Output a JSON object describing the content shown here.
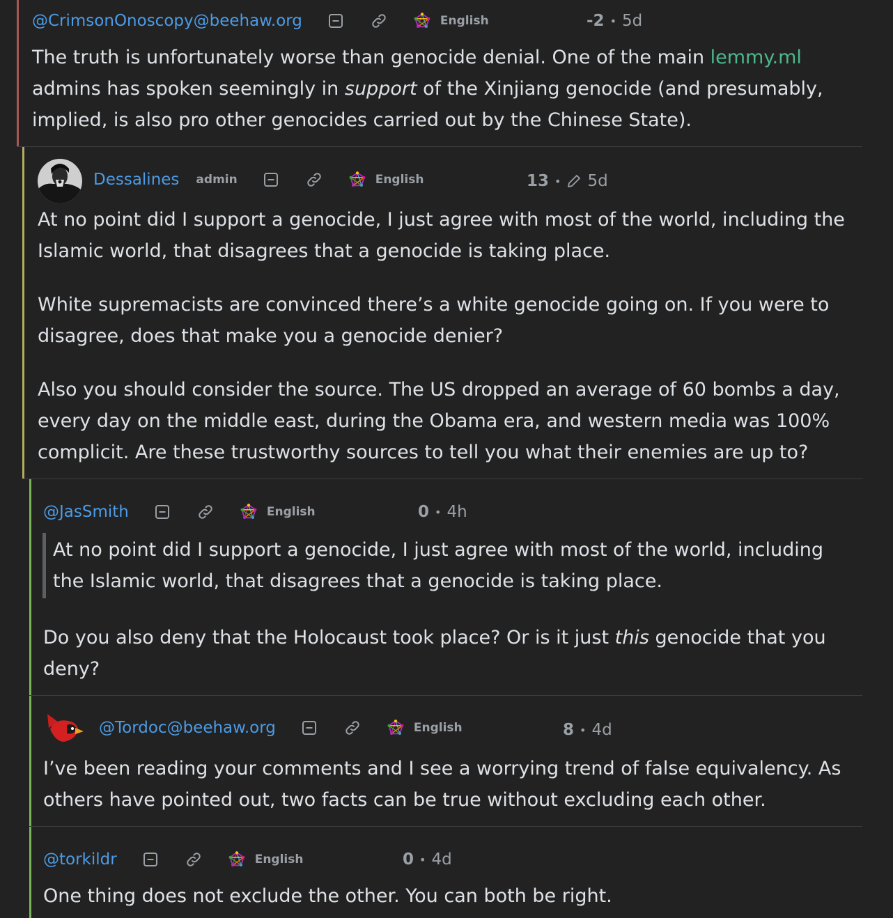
{
  "comments": [
    {
      "username": "@CrimsonOnoscopy@beehaw.org",
      "language": "English",
      "score": "-2",
      "time": "5d",
      "body": {
        "part1": "The truth is unfortunately worse than genocide denial. One of the main ",
        "link": "lemmy.ml",
        "part2": "admins has spoken seemingly in ",
        "emph": "support",
        "part3": " of the Xinjiang genocide (and presumably,",
        "part4": "implied, is also pro other genocides carried out by the Chinese State)."
      },
      "bar_color": "#a85858"
    },
    {
      "username": "Dessalines",
      "badge": "admin",
      "language": "English",
      "score": "13",
      "time": "5d",
      "edited_icon": "pencil-icon",
      "paragraphs": [
        [
          "At no point did I support a genocide, I just agree with most of the world, including the",
          "Islamic world, that disagrees that a genocide is taking place."
        ],
        [
          "White supremacists are convinced there’s a white genocide going on. If you were to",
          "disagree, does that make you a genocide denier?"
        ],
        [
          "Also you should consider the source. The US dropped an average of 60 bombs a day,",
          "every day on the middle east, during the Obama era, and western media was 100%",
          "complicit. Are these trustworthy sources to tell you what their enemies are up to?"
        ]
      ],
      "bar_color": "#b5ad5a"
    },
    {
      "username": "@JasSmith",
      "language": "English",
      "score": "0",
      "time": "4h",
      "quote": [
        "At no point did I support a genocide, I just agree with most of the world, including",
        "the Islamic world, that disagrees that a genocide is taking place."
      ],
      "body": {
        "part1": "Do you also deny that the Holocaust took place? Or is it just ",
        "emph": "this",
        "part2": " genocide that you",
        "part3": "deny?"
      },
      "bar_color": "#7ab55a"
    },
    {
      "username": "@Tordoc@beehaw.org",
      "language": "English",
      "score": "8",
      "time": "4d",
      "paragraphs": [
        [
          "I’ve been reading your comments and I see a worrying trend of false equivalency. As",
          "others have pointed out, two facts can be true without excluding each other."
        ]
      ],
      "bar_color": "#7ab55a"
    },
    {
      "username": "@torkildr",
      "language": "English",
      "score": "0",
      "time": "4d",
      "paragraphs": [
        [
          "One thing does not exclude the other. You can both be right."
        ]
      ],
      "bar_color": "#7ab55a"
    }
  ],
  "icons": {
    "collapse": "collapse-icon",
    "link": "link-icon",
    "fediverse": "fediverse-icon",
    "avatar": "avatar"
  }
}
